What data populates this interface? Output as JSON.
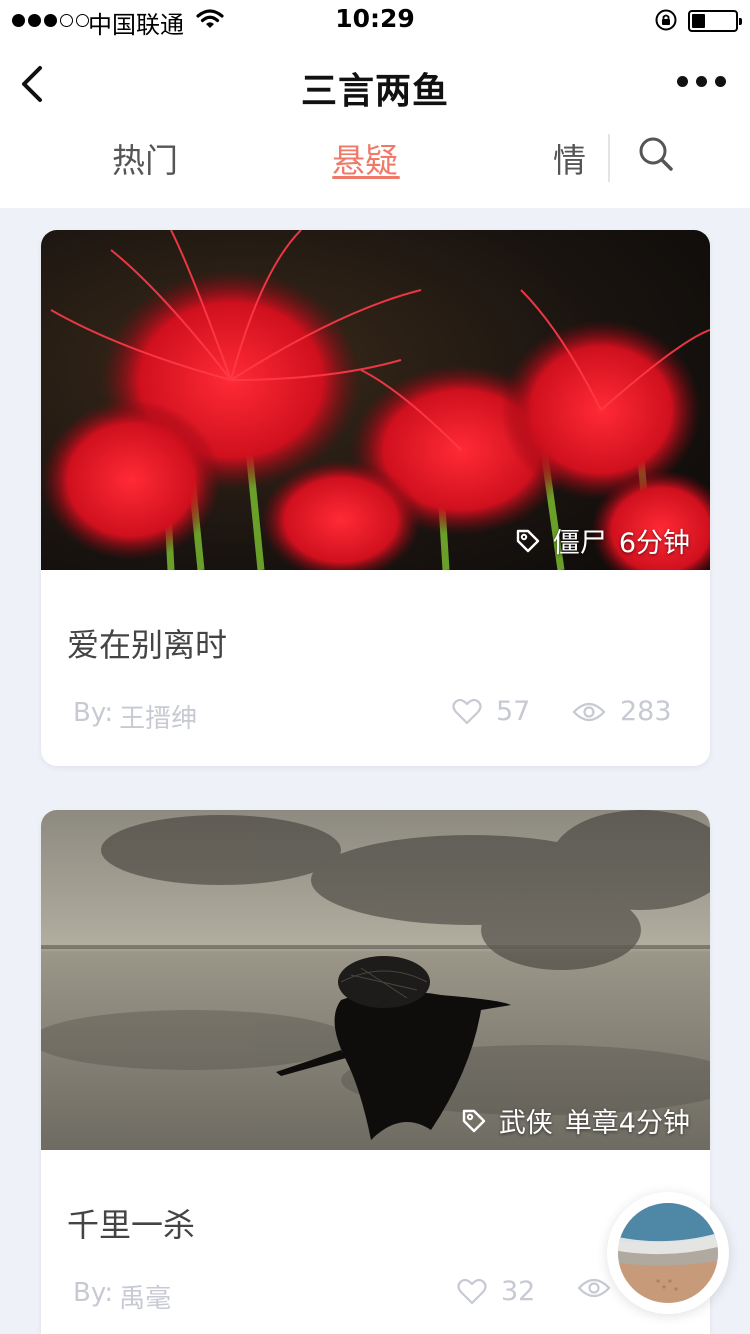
{
  "status_bar": {
    "carrier": "中国联通",
    "time": "10:29"
  },
  "nav": {
    "title": "三言两鱼"
  },
  "tabs": [
    {
      "label": "热门",
      "active": false
    },
    {
      "label": "悬疑",
      "active": true
    },
    {
      "label": "情",
      "active": false
    }
  ],
  "colors": {
    "accent": "#f07a6a",
    "background": "#eef1f8",
    "muted_text": "#c7cad2"
  },
  "cards": [
    {
      "tag": "僵尸",
      "duration": "6分钟",
      "title": "爱在别离时",
      "author_prefix": "By:",
      "author": "王搢绅",
      "likes": "57",
      "views": "283",
      "image_icon": "red-spider-lily-photo"
    },
    {
      "tag": "武侠",
      "duration": "单章4分钟",
      "title": "千里一杀",
      "author_prefix": "By:",
      "author": "禹毫",
      "likes": "32",
      "views": "",
      "image_icon": "ink-painting-swordsman"
    }
  ],
  "fab": {
    "icon": "beach-avatar"
  }
}
